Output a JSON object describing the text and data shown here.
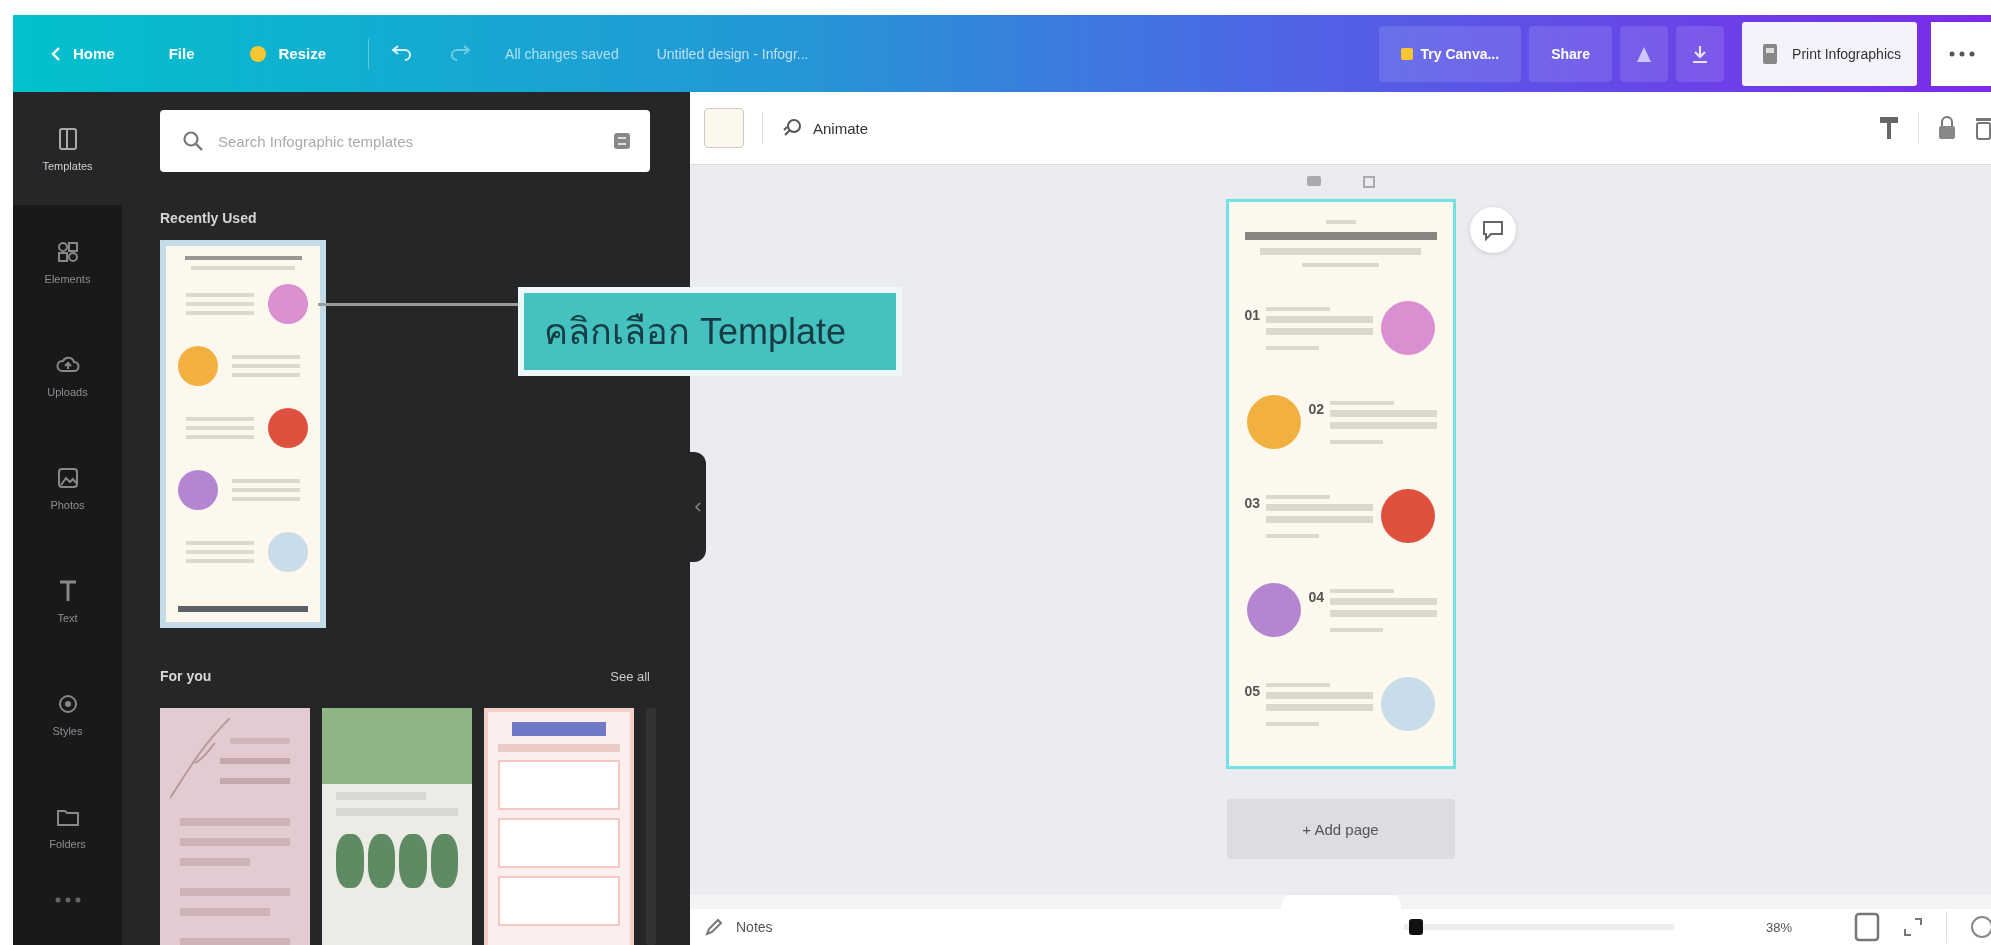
{
  "top_bar": {
    "home": "Home",
    "file": "File",
    "resize": "Resize",
    "status": "All changes saved",
    "design_title": "Untitled design - Infogr...",
    "try_button": "Try Canva...",
    "share_button": "Share",
    "print_button": "Print Infographics"
  },
  "rail": [
    {
      "kind": "templates",
      "label": "Templates",
      "selected": true
    },
    {
      "kind": "elements",
      "label": "Elements",
      "selected": false
    },
    {
      "kind": "uploads",
      "label": "Uploads",
      "selected": false
    },
    {
      "kind": "photos",
      "label": "Photos",
      "selected": false
    },
    {
      "kind": "text",
      "label": "Text",
      "selected": false
    },
    {
      "kind": "styles",
      "label": "Styles",
      "selected": false
    },
    {
      "kind": "folders",
      "label": "Folders",
      "selected": false
    }
  ],
  "panel": {
    "search": {
      "placeholder": "Search Infographic templates"
    },
    "recent_title": "Recently Used",
    "for_you_title": "For you",
    "see_all": "See all",
    "for_you": [
      {
        "kind": "floral"
      },
      {
        "kind": "green"
      },
      {
        "kind": "report"
      }
    ]
  },
  "annotation": "คลิกเลือก Template",
  "toolbar": {
    "animate": "Animate"
  },
  "infographic": {
    "items": [
      {
        "number": "01",
        "color": "#d98fd0",
        "kind": "blob-right"
      },
      {
        "number": "02",
        "color": "#f2b040",
        "kind": "blob-left"
      },
      {
        "number": "03",
        "color": "#e0503f",
        "kind": "blob-right"
      },
      {
        "number": "04",
        "color": "#b585d2",
        "kind": "blob-left"
      },
      {
        "number": "05",
        "color": "#c8dcea",
        "kind": "blob-right"
      }
    ]
  },
  "add_page": "+ Add page",
  "bottom_bar": {
    "notes": "Notes",
    "zoom": {
      "level": 0.02
    },
    "zoom_reading": "38%"
  }
}
